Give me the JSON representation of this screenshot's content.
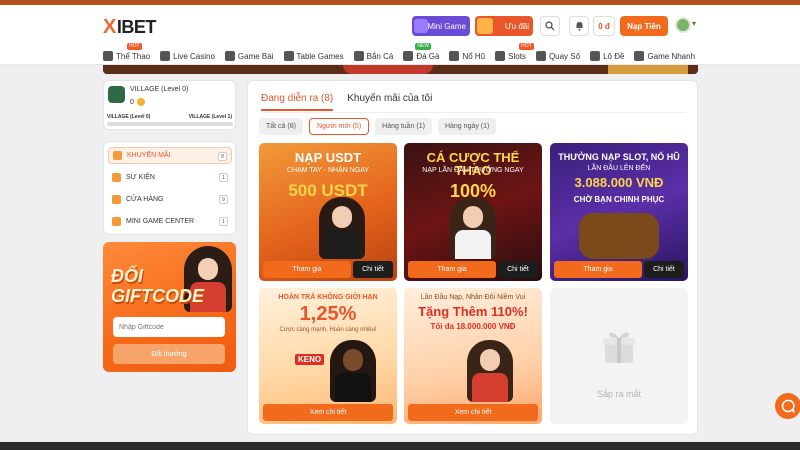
{
  "brand": {
    "logo_x": "X",
    "logo_text": "IBET",
    "accent": "#f26b1d"
  },
  "header": {
    "mini_game": "Mini Game",
    "uu_dai": "Ưu đãi",
    "balance": "0 đ",
    "nap_tien": "Nạp Tiền"
  },
  "nav": [
    {
      "label": "Thể Thao",
      "icon": "ball-icon",
      "badge": "HOT",
      "badge_type": "hot"
    },
    {
      "label": "Live Casino",
      "icon": "dealer-icon",
      "badge": "",
      "badge_type": ""
    },
    {
      "label": "Game Bài",
      "icon": "cards-icon",
      "badge": "",
      "badge_type": ""
    },
    {
      "label": "Table Games",
      "icon": "table-icon",
      "badge": "",
      "badge_type": ""
    },
    {
      "label": "Bắn Cá",
      "icon": "fish-icon",
      "badge": "",
      "badge_type": ""
    },
    {
      "label": "Đá Gà",
      "icon": "rooster-icon",
      "badge": "NEW",
      "badge_type": "new"
    },
    {
      "label": "Nổ Hũ",
      "icon": "jackpot-icon",
      "badge": "",
      "badge_type": ""
    },
    {
      "label": "Slots",
      "icon": "slot-icon",
      "badge": "HOT",
      "badge_type": "hot"
    },
    {
      "label": "Quay Số",
      "icon": "lottery-icon",
      "badge": "",
      "badge_type": ""
    },
    {
      "label": "Lô Đề",
      "icon": "dice-icon",
      "badge": "",
      "badge_type": ""
    },
    {
      "label": "Game Nhanh",
      "icon": "rocket-icon",
      "badge": "",
      "badge_type": ""
    }
  ],
  "user": {
    "level_name": "VILLAGE (Level 0)",
    "points": "0",
    "level_from": "VILLAGE (Level 0)",
    "level_to": "VILLAGE (Level 1)",
    "progress": 0
  },
  "sidebar_menu": [
    {
      "label": "KHUYẾN MÃI",
      "count": "8",
      "active": true
    },
    {
      "label": "SỰ KIỆN",
      "count": "1",
      "active": false
    },
    {
      "label": "CỬA HÀNG",
      "count": "9",
      "active": false
    },
    {
      "label": "MINI GAME CENTER",
      "count": "1",
      "active": false
    }
  ],
  "giftcode": {
    "title": "ĐỔI GIFTCODE",
    "placeholder": "Nhập Giftcode",
    "button": "Đổi thưởng"
  },
  "tabs": [
    "Đang diễn ra (8)",
    "Khuyến mãi của tôi"
  ],
  "filters": [
    "Tất cả (8)",
    "Người mới (5)",
    "Hàng tuần (1)",
    "Hàng ngày (1)"
  ],
  "promos": [
    {
      "line1": "NẠP USDT",
      "line2": "CHẠM TAY - NHẬN NGAY",
      "line3": "500 USDT",
      "join": "Tham gia",
      "detail": "Chi tiết"
    },
    {
      "line1": "CÁ CƯỢC THỂ THAO",
      "line2": "NẠP LẦN ĐẦU THƯỞNG NGAY",
      "line3": "100%",
      "join": "Tham gia",
      "detail": "Chi tiết"
    },
    {
      "line1": "THƯỞNG NẠP SLOT, NỔ HŨ",
      "line2": "LẦN ĐẦU LÊN ĐẾN",
      "line3": "3.088.000 VNĐ",
      "line4": "CHỜ BẠN CHINH PHỤC",
      "join": "Tham gia",
      "detail": "Chi tiết"
    },
    {
      "line1": "HOÀN TRẢ KHÔNG GIỚI HẠN",
      "line2": "Cược càng mạnh, Hoàn càng nhiều!",
      "line3": "1,25%",
      "tag": "KENO",
      "more": "Xem chi tiết"
    },
    {
      "line1": "Lần Đầu Nạp, Nhân Đôi Niềm Vui",
      "line2": "Tối đa 18.000.000 VNĐ",
      "line3": "Tặng Thêm 110%!",
      "more": "Xem chi tiết"
    }
  ],
  "coming_soon": "Sắp ra mắt"
}
